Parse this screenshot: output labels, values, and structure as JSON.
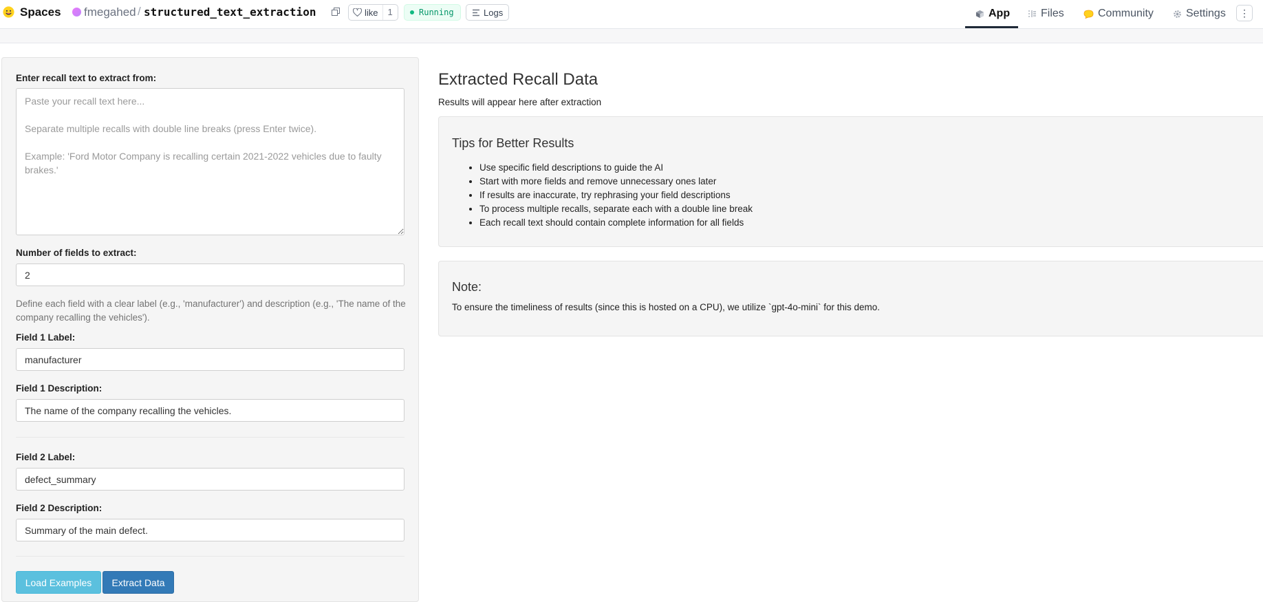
{
  "header": {
    "spaces_label": "Spaces",
    "owner": "fmegahed",
    "separator": "/",
    "repo": "structured_text_extraction",
    "like_label": "like",
    "like_count": "1",
    "status": "Running",
    "logs_label": "Logs",
    "nav": {
      "app": "App",
      "files": "Files",
      "community": "Community",
      "settings": "Settings"
    },
    "more": "⋮",
    "accent_running": "#10b981"
  },
  "form": {
    "recall_label": "Enter recall text to extract from:",
    "recall_placeholder": "Paste your recall text here...\n\nSeparate multiple recalls with double line breaks (press Enter twice).\n\nExample: 'Ford Motor Company is recalling certain 2021-2022 vehicles due to faulty brakes.'",
    "num_fields_label": "Number of fields to extract:",
    "num_fields_value": "2",
    "help_text": "Define each field with a clear label (e.g., 'manufacturer') and description (e.g., 'The name of the company recalling the vehicles').",
    "fields": [
      {
        "label_title": "Field 1 Label:",
        "label_value": "manufacturer",
        "desc_title": "Field 1 Description:",
        "desc_value": "The name of the company recalling the vehicles."
      },
      {
        "label_title": "Field 2 Label:",
        "label_value": "defect_summary",
        "desc_title": "Field 2 Description:",
        "desc_value": "Summary of the main defect."
      }
    ],
    "load_examples_label": "Load Examples",
    "extract_label": "Extract Data"
  },
  "results": {
    "title": "Extracted Recall Data",
    "subtitle": "Results will appear here after extraction",
    "tips_title": "Tips for Better Results",
    "tips": [
      "Use specific field descriptions to guide the AI",
      "Start with more fields and remove unnecessary ones later",
      "If results are inaccurate, try rephrasing your field descriptions",
      "To process multiple recalls, separate each with a double line break",
      "Each recall text should contain complete information for all fields"
    ],
    "note_title": "Note:",
    "note_text": "To ensure the timeliness of results (since this is hosted on a CPU), we utilize `gpt-4o-mini` for this demo."
  }
}
